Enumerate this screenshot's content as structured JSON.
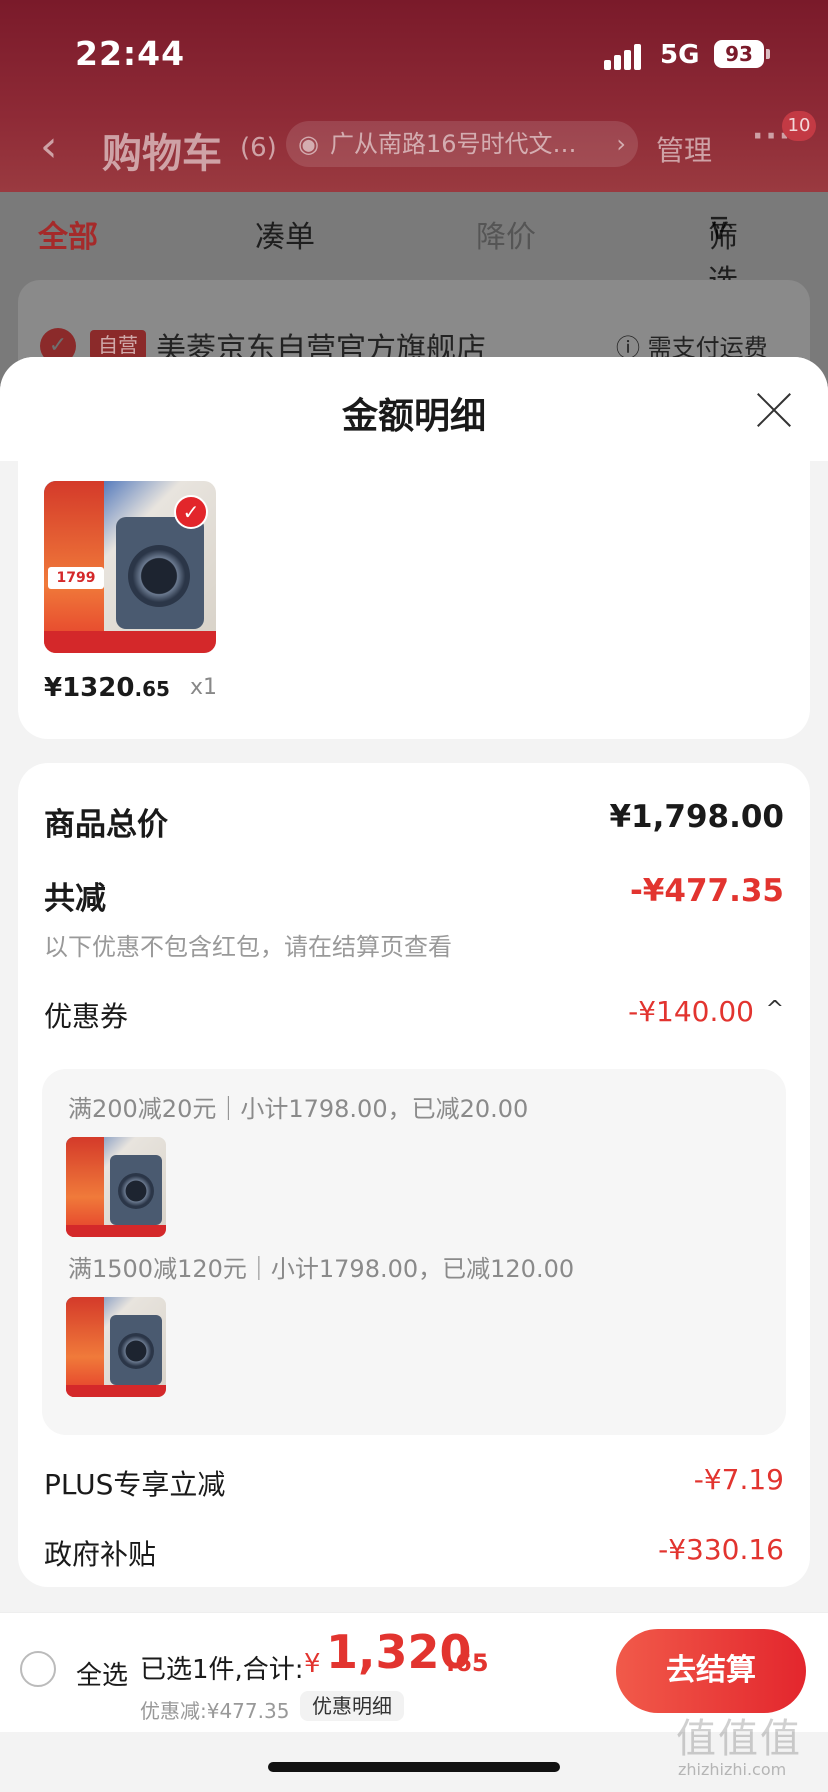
{
  "status_bar": {
    "time": "22:44",
    "network": "5G",
    "battery": "93"
  },
  "cart_header": {
    "title": "购物车",
    "count": "(6)",
    "address": "广从南路16号时代文…",
    "manage": "管理",
    "more_badge": "10"
  },
  "cart_tabs": {
    "all": "全部",
    "combine": "凑单",
    "price_drop": "降价",
    "filter": "筛选"
  },
  "store": {
    "tag": "自营",
    "name": "美菱京东自营官方旗舰店",
    "shipping": "需支付运费"
  },
  "sheet": {
    "title": "金额明细",
    "product": {
      "currency": "¥",
      "price_int": "1320",
      "price_dec": ".65",
      "quantity": "x1"
    },
    "total": {
      "label": "商品总价",
      "value": "¥1,798.00"
    },
    "reduction": {
      "label": "共减",
      "value": "-¥477.35",
      "note": "以下优惠不包含红包，请在结算页查看"
    },
    "coupon": {
      "label": "优惠券",
      "value": "-¥140.00",
      "items": [
        {
          "text": "满200减20元｜小计1798.00，已减20.00"
        },
        {
          "text": "满1500减120元｜小计1798.00，已减120.00"
        }
      ]
    },
    "plus": {
      "label": "PLUS专享立减",
      "value": "-¥7.19"
    },
    "gov": {
      "label": "政府补贴",
      "value": "-¥330.16"
    }
  },
  "bottom_bar": {
    "select_all": "全选",
    "summary_label": "已选1件,合计:",
    "currency": "¥",
    "total_int": "1,320",
    "total_dec": ".65",
    "savings": "优惠减:¥477.35",
    "detail_chip": "优惠明细",
    "checkout": "去结算"
  },
  "watermark": {
    "text": "值值值",
    "sub": "zhizhizhi.com"
  },
  "colors": {
    "accent_red": "#e2342f",
    "header_maroon": "#7a1a2a"
  }
}
